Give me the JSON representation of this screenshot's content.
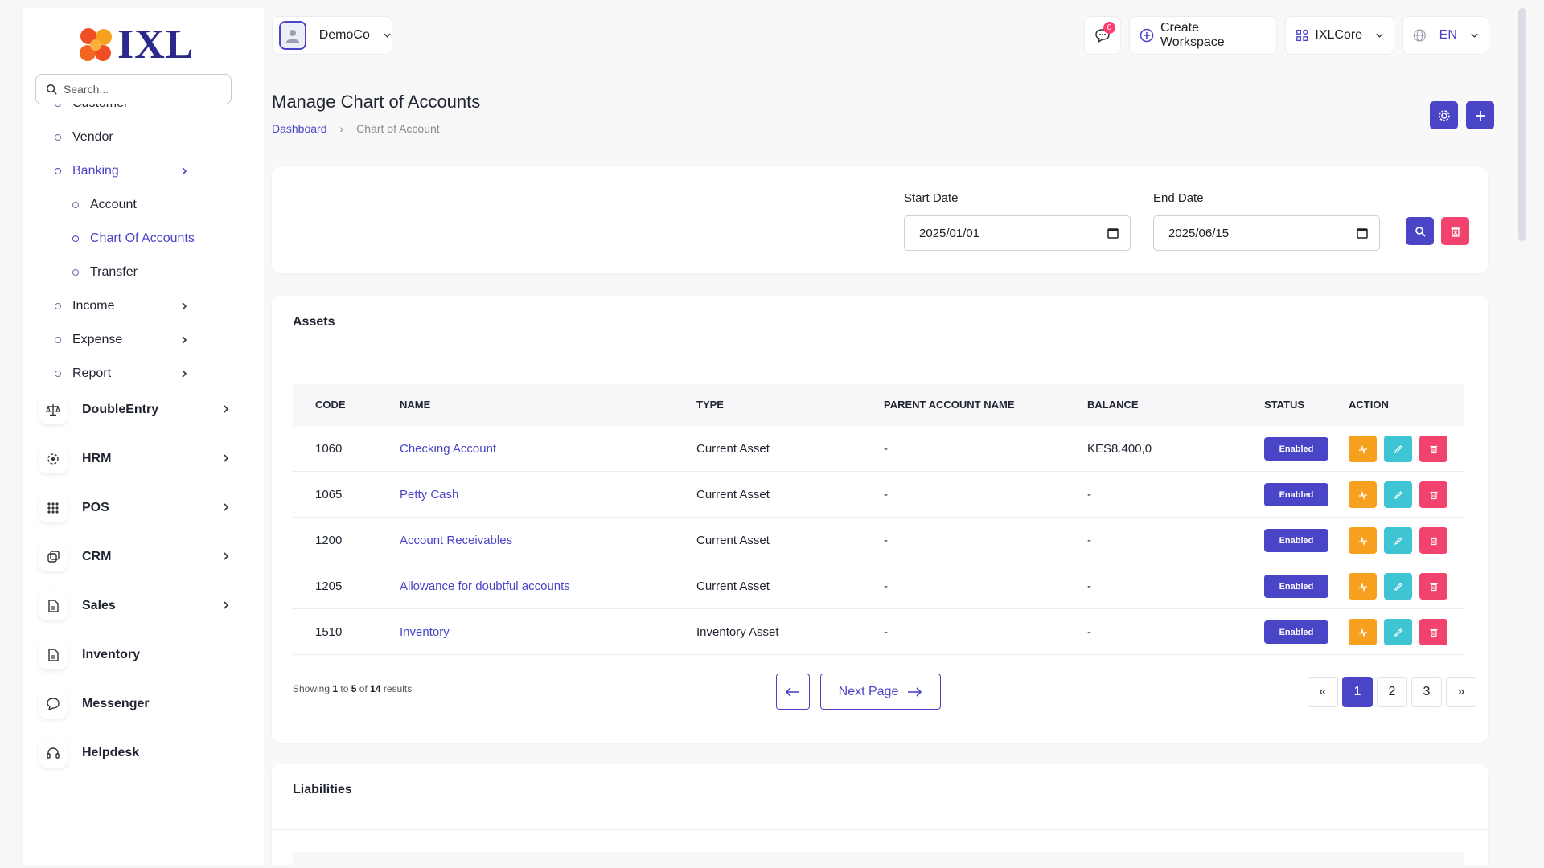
{
  "brand": {
    "logo_text": "IXL"
  },
  "sidebar": {
    "search_placeholder": "Search...",
    "partial_item": "Customer",
    "items": [
      {
        "label": "Vendor"
      },
      {
        "label": "Banking"
      },
      {
        "label": "Account"
      },
      {
        "label": "Chart Of Accounts"
      },
      {
        "label": "Transfer"
      },
      {
        "label": "Income"
      },
      {
        "label": "Expense"
      },
      {
        "label": "Report"
      }
    ],
    "modules": [
      {
        "label": "DoubleEntry",
        "icon": "scale-icon"
      },
      {
        "label": "HRM",
        "icon": "hrm-icon"
      },
      {
        "label": "POS",
        "icon": "grid-icon"
      },
      {
        "label": "CRM",
        "icon": "crm-icon"
      },
      {
        "label": "Sales",
        "icon": "file-icon"
      },
      {
        "label": "Inventory",
        "icon": "file-icon"
      },
      {
        "label": "Messenger",
        "icon": "chat-icon"
      },
      {
        "label": "Helpdesk",
        "icon": "headset-icon"
      }
    ]
  },
  "header": {
    "company": "DemoCo",
    "notification_count": "0",
    "create_workspace": "Create Workspace",
    "workspace": "IXLCore",
    "language": "EN"
  },
  "page": {
    "title": "Manage Chart of Accounts",
    "breadcrumb_home": "Dashboard",
    "breadcrumb_current": "Chart of Account"
  },
  "filter": {
    "start_label": "Start Date",
    "start_value": "2025/01/01",
    "end_label": "End Date",
    "end_value": "2025/06/15"
  },
  "assets": {
    "title": "Assets",
    "columns": [
      "CODE",
      "NAME",
      "TYPE",
      "PARENT ACCOUNT NAME",
      "BALANCE",
      "STATUS",
      "ACTION"
    ],
    "rows": [
      {
        "code": "1060",
        "name": "Checking Account",
        "type": "Current Asset",
        "parent": "-",
        "balance": "KES8.400,0",
        "status": "Enabled"
      },
      {
        "code": "1065",
        "name": "Petty Cash",
        "type": "Current Asset",
        "parent": "-",
        "balance": "-",
        "status": "Enabled"
      },
      {
        "code": "1200",
        "name": "Account Receivables",
        "type": "Current Asset",
        "parent": "-",
        "balance": "-",
        "status": "Enabled"
      },
      {
        "code": "1205",
        "name": "Allowance for doubtful accounts",
        "type": "Current Asset",
        "parent": "-",
        "balance": "-",
        "status": "Enabled"
      },
      {
        "code": "1510",
        "name": "Inventory",
        "type": "Inventory Asset",
        "parent": "-",
        "balance": "-",
        "status": "Enabled"
      }
    ],
    "showing": {
      "prefix": "Showing",
      "from": "1",
      "to_word": "to",
      "to": "5",
      "of_word": "of",
      "total": "14",
      "suffix": "results"
    },
    "next_page": "Next Page",
    "pages": [
      "1",
      "2",
      "3"
    ],
    "first_symbol": "«",
    "last_symbol": "»"
  },
  "liabilities": {
    "title": "Liabilities"
  },
  "colors": {
    "primary": "#4a45c7",
    "warning": "#f7a01e",
    "info": "#3fc4d4",
    "danger": "#f2426e",
    "badge": "#ff3a6e"
  }
}
